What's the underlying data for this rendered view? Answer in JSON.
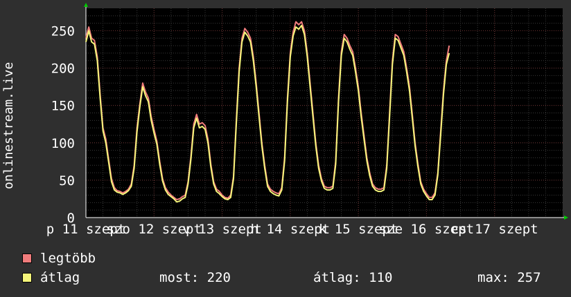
{
  "chart_data": {
    "type": "line",
    "ylabel": "onlinestream.live",
    "ylim": [
      0,
      280
    ],
    "yticks": [
      0,
      50,
      100,
      150,
      200,
      250
    ],
    "grid": true,
    "xlim": [
      0,
      168
    ],
    "xtick_labels": [
      {
        "x": 0,
        "label": "p 11 szept"
      },
      {
        "x": 24,
        "label": "szo 12 szept"
      },
      {
        "x": 48,
        "label": "v 13 szept"
      },
      {
        "x": 72,
        "label": "h 14 szept"
      },
      {
        "x": 96,
        "label": "k 15 szept"
      },
      {
        "x": 120,
        "label": "sze 16 szept"
      },
      {
        "x": 144,
        "label": "cs 17 szept"
      }
    ],
    "series": [
      {
        "name": "legtöbb",
        "color": "#f07c7c",
        "points": [
          [
            0,
            240
          ],
          [
            1,
            255
          ],
          [
            2,
            240
          ],
          [
            3,
            237
          ],
          [
            4,
            215
          ],
          [
            5,
            165
          ],
          [
            6,
            120
          ],
          [
            7,
            105
          ],
          [
            8,
            78
          ],
          [
            9,
            52
          ],
          [
            10,
            40
          ],
          [
            11,
            36
          ],
          [
            12,
            35
          ],
          [
            13,
            33
          ],
          [
            14,
            35
          ],
          [
            15,
            38
          ],
          [
            16,
            45
          ],
          [
            17,
            70
          ],
          [
            18,
            120
          ],
          [
            19,
            152
          ],
          [
            20,
            180
          ],
          [
            21,
            168
          ],
          [
            22,
            160
          ],
          [
            23,
            135
          ],
          [
            24,
            118
          ],
          [
            25,
            102
          ],
          [
            26,
            75
          ],
          [
            27,
            52
          ],
          [
            28,
            40
          ],
          [
            29,
            34
          ],
          [
            30,
            30
          ],
          [
            31,
            27
          ],
          [
            32,
            24
          ],
          [
            33,
            25
          ],
          [
            34,
            28
          ],
          [
            35,
            30
          ],
          [
            36,
            48
          ],
          [
            37,
            82
          ],
          [
            38,
            125
          ],
          [
            39,
            138
          ],
          [
            40,
            125
          ],
          [
            41,
            127
          ],
          [
            42,
            123
          ],
          [
            43,
            105
          ],
          [
            44,
            72
          ],
          [
            45,
            48
          ],
          [
            46,
            38
          ],
          [
            47,
            35
          ],
          [
            48,
            30
          ],
          [
            49,
            27
          ],
          [
            50,
            26
          ],
          [
            51,
            30
          ],
          [
            52,
            55
          ],
          [
            53,
            130
          ],
          [
            54,
            200
          ],
          [
            55,
            240
          ],
          [
            56,
            253
          ],
          [
            57,
            248
          ],
          [
            58,
            240
          ],
          [
            59,
            215
          ],
          [
            60,
            180
          ],
          [
            61,
            140
          ],
          [
            62,
            100
          ],
          [
            63,
            70
          ],
          [
            64,
            45
          ],
          [
            65,
            38
          ],
          [
            66,
            35
          ],
          [
            67,
            33
          ],
          [
            68,
            32
          ],
          [
            69,
            40
          ],
          [
            70,
            80
          ],
          [
            71,
            160
          ],
          [
            72,
            220
          ],
          [
            73,
            248
          ],
          [
            74,
            262
          ],
          [
            75,
            258
          ],
          [
            76,
            262
          ],
          [
            77,
            250
          ],
          [
            78,
            220
          ],
          [
            79,
            180
          ],
          [
            80,
            140
          ],
          [
            81,
            100
          ],
          [
            82,
            70
          ],
          [
            83,
            52
          ],
          [
            84,
            42
          ],
          [
            85,
            40
          ],
          [
            86,
            40
          ],
          [
            87,
            42
          ],
          [
            88,
            75
          ],
          [
            89,
            160
          ],
          [
            90,
            222
          ],
          [
            91,
            245
          ],
          [
            92,
            240
          ],
          [
            93,
            230
          ],
          [
            94,
            222
          ],
          [
            95,
            200
          ],
          [
            96,
            175
          ],
          [
            97,
            140
          ],
          [
            98,
            110
          ],
          [
            99,
            80
          ],
          [
            100,
            60
          ],
          [
            101,
            45
          ],
          [
            102,
            40
          ],
          [
            103,
            38
          ],
          [
            104,
            38
          ],
          [
            105,
            40
          ],
          [
            106,
            70
          ],
          [
            107,
            140
          ],
          [
            108,
            210
          ],
          [
            109,
            245
          ],
          [
            110,
            242
          ],
          [
            111,
            232
          ],
          [
            112,
            222
          ],
          [
            113,
            200
          ],
          [
            114,
            175
          ],
          [
            115,
            138
          ],
          [
            116,
            100
          ],
          [
            117,
            72
          ],
          [
            118,
            48
          ],
          [
            119,
            38
          ],
          [
            120,
            32
          ],
          [
            121,
            27
          ],
          [
            122,
            27
          ],
          [
            123,
            33
          ],
          [
            124,
            60
          ],
          [
            125,
            115
          ],
          [
            126,
            170
          ],
          [
            127,
            210
          ],
          [
            128,
            230
          ]
        ]
      },
      {
        "name": "átlag",
        "color": "#f5f57a",
        "points": [
          [
            0,
            235
          ],
          [
            1,
            250
          ],
          [
            2,
            235
          ],
          [
            3,
            232
          ],
          [
            4,
            210
          ],
          [
            5,
            160
          ],
          [
            6,
            116
          ],
          [
            7,
            100
          ],
          [
            8,
            74
          ],
          [
            9,
            48
          ],
          [
            10,
            37
          ],
          [
            11,
            34
          ],
          [
            12,
            33
          ],
          [
            13,
            31
          ],
          [
            14,
            33
          ],
          [
            15,
            36
          ],
          [
            16,
            42
          ],
          [
            17,
            66
          ],
          [
            18,
            115
          ],
          [
            19,
            148
          ],
          [
            20,
            175
          ],
          [
            21,
            163
          ],
          [
            22,
            155
          ],
          [
            23,
            130
          ],
          [
            24,
            113
          ],
          [
            25,
            98
          ],
          [
            26,
            71
          ],
          [
            27,
            49
          ],
          [
            28,
            37
          ],
          [
            29,
            31
          ],
          [
            30,
            28
          ],
          [
            31,
            25
          ],
          [
            32,
            21
          ],
          [
            33,
            22
          ],
          [
            34,
            25
          ],
          [
            35,
            27
          ],
          [
            36,
            45
          ],
          [
            37,
            78
          ],
          [
            38,
            120
          ],
          [
            39,
            133
          ],
          [
            40,
            120
          ],
          [
            41,
            122
          ],
          [
            42,
            118
          ],
          [
            43,
            100
          ],
          [
            44,
            68
          ],
          [
            45,
            45
          ],
          [
            46,
            35
          ],
          [
            47,
            32
          ],
          [
            48,
            28
          ],
          [
            49,
            25
          ],
          [
            50,
            24
          ],
          [
            51,
            27
          ],
          [
            52,
            52
          ],
          [
            53,
            125
          ],
          [
            54,
            195
          ],
          [
            55,
            235
          ],
          [
            56,
            248
          ],
          [
            57,
            243
          ],
          [
            58,
            235
          ],
          [
            59,
            210
          ],
          [
            60,
            175
          ],
          [
            61,
            135
          ],
          [
            62,
            96
          ],
          [
            63,
            66
          ],
          [
            64,
            42
          ],
          [
            65,
            35
          ],
          [
            66,
            32
          ],
          [
            67,
            30
          ],
          [
            68,
            29
          ],
          [
            69,
            37
          ],
          [
            70,
            76
          ],
          [
            71,
            155
          ],
          [
            72,
            215
          ],
          [
            73,
            243
          ],
          [
            74,
            255
          ],
          [
            75,
            252
          ],
          [
            76,
            257
          ],
          [
            77,
            245
          ],
          [
            78,
            215
          ],
          [
            79,
            175
          ],
          [
            80,
            135
          ],
          [
            81,
            96
          ],
          [
            82,
            66
          ],
          [
            83,
            49
          ],
          [
            84,
            39
          ],
          [
            85,
            37
          ],
          [
            86,
            37
          ],
          [
            87,
            39
          ],
          [
            88,
            71
          ],
          [
            89,
            155
          ],
          [
            90,
            217
          ],
          [
            91,
            240
          ],
          [
            92,
            235
          ],
          [
            93,
            225
          ],
          [
            94,
            217
          ],
          [
            95,
            195
          ],
          [
            96,
            170
          ],
          [
            97,
            135
          ],
          [
            98,
            105
          ],
          [
            99,
            76
          ],
          [
            100,
            56
          ],
          [
            101,
            42
          ],
          [
            102,
            37
          ],
          [
            103,
            35
          ],
          [
            104,
            35
          ],
          [
            105,
            37
          ],
          [
            106,
            66
          ],
          [
            107,
            135
          ],
          [
            108,
            205
          ],
          [
            109,
            240
          ],
          [
            110,
            237
          ],
          [
            111,
            227
          ],
          [
            112,
            217
          ],
          [
            113,
            195
          ],
          [
            114,
            170
          ],
          [
            115,
            133
          ],
          [
            116,
            96
          ],
          [
            117,
            68
          ],
          [
            118,
            45
          ],
          [
            119,
            35
          ],
          [
            120,
            29
          ],
          [
            121,
            24
          ],
          [
            122,
            24
          ],
          [
            123,
            30
          ],
          [
            124,
            57
          ],
          [
            125,
            110
          ],
          [
            126,
            165
          ],
          [
            127,
            205
          ],
          [
            128,
            220
          ]
        ]
      }
    ]
  },
  "legend": [
    {
      "label": "legtöbb",
      "color": "#f07c7c"
    },
    {
      "label": "átlag",
      "color": "#f5f57a"
    }
  ],
  "stats": {
    "current": "most: 220",
    "average": "átlag: 110",
    "max": "max: 257"
  }
}
